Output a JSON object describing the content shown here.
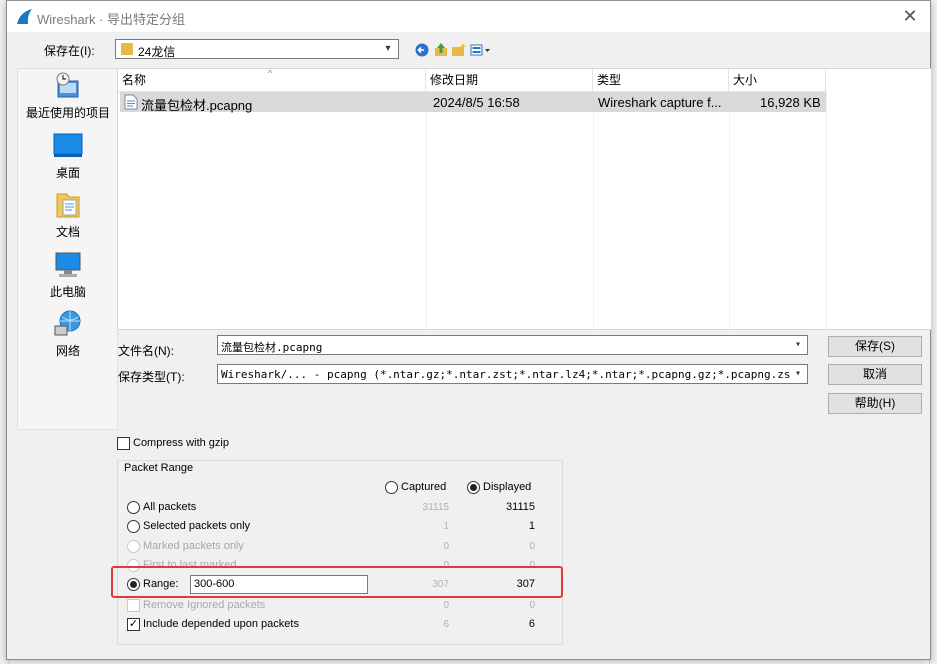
{
  "window": {
    "title": "Wireshark · 导出特定分组",
    "close_label": "✕"
  },
  "location": {
    "label": "保存在(I):",
    "folder": "24龙信"
  },
  "places": [
    {
      "label": "最近使用的项目",
      "icon": "recent-icon"
    },
    {
      "label": "桌面",
      "icon": "desktop-icon"
    },
    {
      "label": "文档",
      "icon": "documents-icon"
    },
    {
      "label": "此电脑",
      "icon": "computer-icon"
    },
    {
      "label": "网络",
      "icon": "network-icon"
    }
  ],
  "file_list": {
    "headers": {
      "name": "名称",
      "modified": "修改日期",
      "type": "类型",
      "size": "大小"
    },
    "files": [
      {
        "name": "流量包检材.pcapng",
        "modified": "2024/8/5 16:58",
        "type": "Wireshark capture f...",
        "size": "16,928 KB"
      }
    ]
  },
  "filename": {
    "label": "文件名(N):",
    "value": "流量包检材.pcapng"
  },
  "filetype": {
    "label": "保存类型(T):",
    "value": "Wireshark/... - pcapng (*.ntar.gz;*.ntar.zst;*.ntar.lz4;*.ntar;*.pcapng.gz;*.pcapng.zst"
  },
  "buttons": {
    "save": "保存(S)",
    "cancel": "取消",
    "help": "帮助(H)"
  },
  "compress": {
    "label": "Compress with gzip",
    "checked": false
  },
  "packet_range": {
    "title": "Packet Range",
    "captured_label": "Captured",
    "displayed_label": "Displayed",
    "rows": [
      {
        "label": "All packets",
        "captured": "31115",
        "displayed": "31115"
      },
      {
        "label": "Selected packets only",
        "captured": "1",
        "displayed": "1"
      },
      {
        "label": "Marked packets only",
        "captured": "0",
        "displayed": "0"
      },
      {
        "label": "First to last marked",
        "captured": "0",
        "displayed": "0"
      },
      {
        "label": "Range:",
        "captured": "307",
        "displayed": "307",
        "value": "300-600"
      },
      {
        "label": "Remove Ignored packets",
        "captured": "0",
        "displayed": "0"
      },
      {
        "label": "Include depended upon packets",
        "captured": "6",
        "displayed": "6"
      }
    ]
  },
  "colors": {
    "highlight": "#e03a3a",
    "selected_row": "#d9d9d9"
  }
}
